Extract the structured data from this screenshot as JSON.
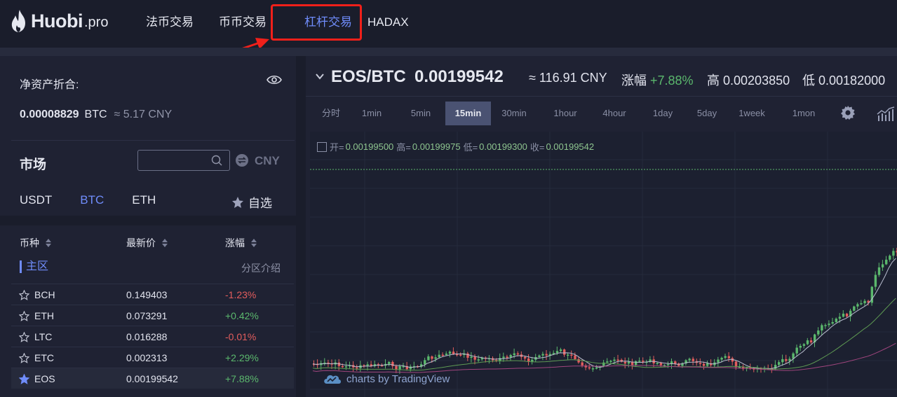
{
  "brand": {
    "name": "Huobi",
    "suffix": ".pro"
  },
  "nav": [
    {
      "label": "法币交易"
    },
    {
      "label": "币币交易"
    },
    {
      "label": "杠杆交易"
    },
    {
      "label": "HADAX"
    }
  ],
  "nav_active": 2,
  "annotation_color": "#f0201a",
  "accent": "#6f8cfa",
  "account": {
    "label": "净资产折合:",
    "btc_value": "0.00008829",
    "btc_unit": "BTC",
    "cny_value": "≈ 5.17 CNY"
  },
  "market": {
    "title": "市场",
    "search_placeholder": "",
    "currency_toggle": "CNY",
    "tabs": [
      {
        "label": "USDT"
      },
      {
        "label": "BTC"
      },
      {
        "label": "ETH"
      }
    ],
    "active_tab": 1,
    "favorites_label": "自选",
    "columns": {
      "symbol": "币种",
      "price": "最新价",
      "change": "涨幅"
    },
    "zone_label": "主区",
    "zone_intro": "分区介绍",
    "rows": [
      {
        "symbol": "BCH",
        "price": "0.149403",
        "change": "-1.23%",
        "dir": "down",
        "fav": false
      },
      {
        "symbol": "ETH",
        "price": "0.073291",
        "change": "+0.42%",
        "dir": "up",
        "fav": false
      },
      {
        "symbol": "LTC",
        "price": "0.016288",
        "change": "-0.01%",
        "dir": "down",
        "fav": false
      },
      {
        "symbol": "ETC",
        "price": "0.002313",
        "change": "+2.29%",
        "dir": "up",
        "fav": false
      },
      {
        "symbol": "EOS",
        "price": "0.00199542",
        "change": "+7.88%",
        "dir": "up",
        "fav": true
      }
    ]
  },
  "ticker": {
    "pair": "EOS/BTC",
    "last": "0.00199542",
    "cny": "≈ 116.91 CNY",
    "change_label": "涨幅",
    "change": "+7.88%",
    "high_label": "高",
    "high": "0.00203850",
    "low_label": "低",
    "low": "0.00182000"
  },
  "intervals": [
    "分时",
    "1min",
    "5min",
    "15min",
    "30min",
    "1hour",
    "4hour",
    "1day",
    "5day",
    "1week",
    "1mon"
  ],
  "active_interval": "15min",
  "ohlc": {
    "open_label": "开=",
    "open": "0.00199500",
    "high_label": "高=",
    "high": "0.00199975",
    "low_label": "低=",
    "low": "0.00199300",
    "close_label": "收=",
    "close": "0.00199542"
  },
  "watermark": "charts by TradingView",
  "chart_colors": {
    "up": "#5bb86d",
    "down": "#e35d5d",
    "ma1": "#b9bed0",
    "ma2": "#5e9a53",
    "ma3": "#a0457e"
  }
}
